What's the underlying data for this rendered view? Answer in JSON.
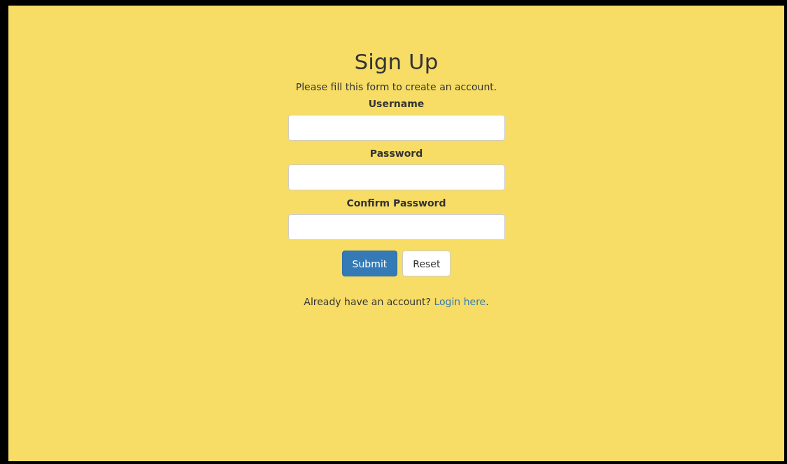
{
  "title": "Sign Up",
  "subtitle": "Please fill this form to create an account.",
  "fields": [
    {
      "label": "Username"
    },
    {
      "label": "Password"
    },
    {
      "label": "Confirm Password"
    }
  ],
  "buttons": [
    {
      "label": "Submit",
      "kind": "primary"
    },
    {
      "label": "Reset",
      "kind": "default"
    }
  ],
  "footer": {
    "text": "Already have an account?",
    "link": "Login here",
    "after": "."
  }
}
